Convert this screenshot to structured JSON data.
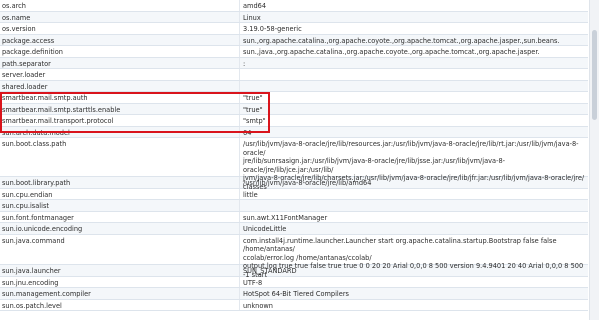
{
  "properties": [
    {
      "key": "os.arch",
      "value": "amd64"
    },
    {
      "key": "os.name",
      "value": "Linux"
    },
    {
      "key": "os.version",
      "value": "3.19.0-58-generic"
    },
    {
      "key": "package.access",
      "value": "sun.,org.apache.catalina.,org.apache.coyote.,org.apache.tomcat.,org.apache.jasper.,sun.beans."
    },
    {
      "key": "package.definition",
      "value": "sun.,java.,org.apache.catalina.,org.apache.coyote.,org.apache.tomcat.,org.apache.jasper."
    },
    {
      "key": "path.separator",
      "value": ":"
    },
    {
      "key": "server.loader",
      "value": ""
    },
    {
      "key": "shared.loader",
      "value": ""
    },
    {
      "key": "smartbear.mail.smtp.auth",
      "value": "\"true\""
    },
    {
      "key": "smartbear.mail.smtp.starttls.enable",
      "value": "\"true\""
    },
    {
      "key": "smartbear.mail.transport.protocol",
      "value": "\"smtp\""
    },
    {
      "key": "sun.arch.data.model",
      "value": "64"
    },
    {
      "key": "sun.boot.class.path",
      "value": "/usr/lib/jvm/java-8-oracle/jre/lib/resources.jar:/usr/lib/jvm/java-8-oracle/jre/lib/rt.jar:/usr/lib/jvm/java-8-oracle/\njre/lib/sunrsasign.jar:/usr/lib/jvm/java-8-oracle/jre/lib/jsse.jar:/usr/lib/jvm/java-8-oracle/jre/lib/jce.jar:/usr/lib/\njvm/java-8-oracle/jre/lib/charsets.jar:/usr/lib/jvm/java-8-oracle/jre/lib/jfr.jar:/usr/lib/jvm/java-8-oracle/jre/\nclasses"
    },
    {
      "key": "sun.boot.library.path",
      "value": "/usr/lib/jvm/java-8-oracle/jre/lib/amd64"
    },
    {
      "key": "sun.cpu.endian",
      "value": "little"
    },
    {
      "key": "sun.cpu.isalist",
      "value": ""
    },
    {
      "key": "sun.font.fontmanager",
      "value": "sun.awt.X11FontManager"
    },
    {
      "key": "sun.io.unicode.encoding",
      "value": "UnicodeLittle"
    },
    {
      "key": "sun.java.command",
      "value": "com.install4j.runtime.launcher.Launcher start org.apache.catalina.startup.Bootstrap false false /home/antanas/\nccolab/error.log /home/antanas/ccolab/\noutput.log true true false  true true 0 0  20 20 Arial 0,0,0 8 500 version 9.4.9401 20 40 Arial 0,0,0 8 500 -1 start"
    },
    {
      "key": "sun.java.launcher",
      "value": "SUN_STANDARD"
    },
    {
      "key": "sun.jnu.encoding",
      "value": "UTF-8"
    },
    {
      "key": "sun.management.compiler",
      "value": "HotSpot 64-Bit Tiered Compilers"
    },
    {
      "key": "sun.os.patch.level",
      "value": "unknown"
    }
  ]
}
